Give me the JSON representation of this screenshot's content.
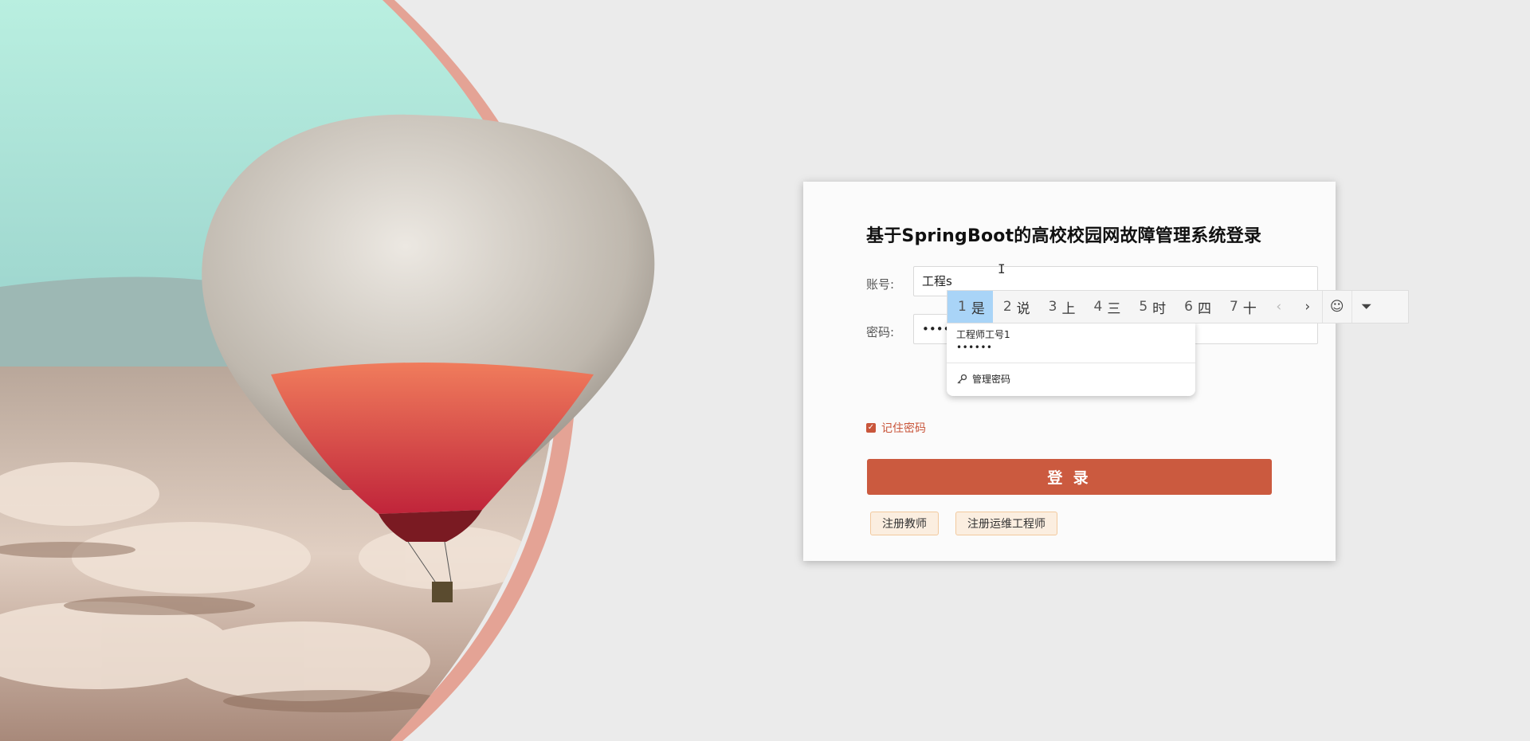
{
  "login": {
    "title": "基于SpringBoot的高校校园网故障管理系统登录",
    "account_label": "账号:",
    "account_value": "工程s",
    "password_label": "密码:",
    "password_value": "••••••",
    "remember_label": "记住密码",
    "remember_checked": true,
    "login_button": "登 录",
    "register_teacher_button": "注册教师",
    "register_engineer_button": "注册运维工程师"
  },
  "autofill": {
    "username": "工程师工号1",
    "password_mask": "••••••",
    "manage_label": "管理密码",
    "manage_icon": "key-icon"
  },
  "ime": {
    "candidates": [
      {
        "num": "1",
        "text": "是",
        "active": true
      },
      {
        "num": "2",
        "text": "说",
        "active": false
      },
      {
        "num": "3",
        "text": "上",
        "active": false
      },
      {
        "num": "4",
        "text": "三",
        "active": false
      },
      {
        "num": "5",
        "text": "时",
        "active": false
      },
      {
        "num": "6",
        "text": "四",
        "active": false
      },
      {
        "num": "7",
        "text": "十",
        "active": false
      }
    ],
    "prev_icon": "‹",
    "next_icon": "›",
    "emoji_icon": "☺",
    "expand_icon": "⏷"
  },
  "colors": {
    "accent": "#cb5a3f",
    "page_bg": "#ebebeb",
    "register_bg": "#fbeee0",
    "ime_highlight": "#a9d4f7"
  }
}
